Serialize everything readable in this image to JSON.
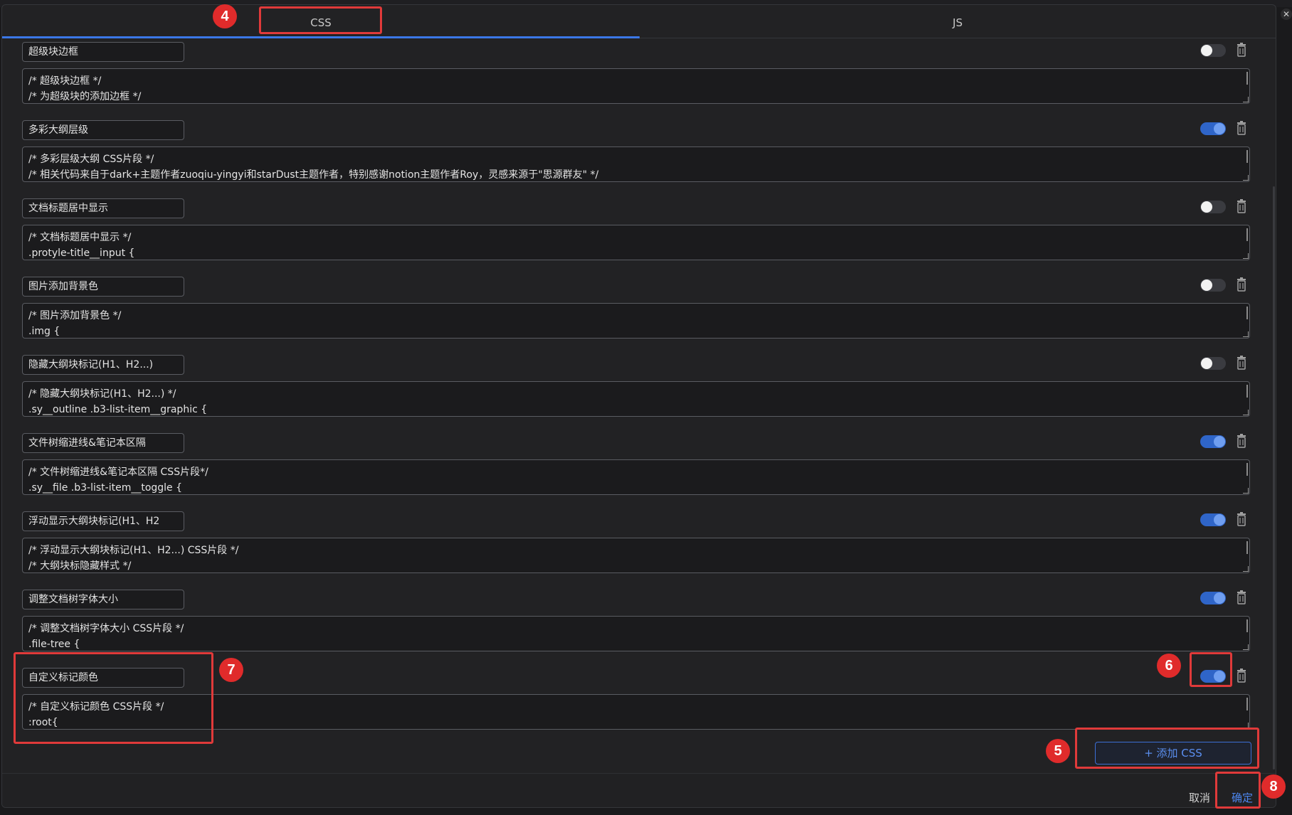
{
  "tabs": {
    "css_label": "CSS",
    "js_label": "JS"
  },
  "snippets": [
    {
      "name": "超级块边框",
      "enabled": false,
      "code": [
        "/* 超级块边框 */",
        "/* 为超级块的添加边框 */"
      ]
    },
    {
      "name": "多彩大纲层级",
      "enabled": true,
      "code": [
        "/* 多彩层级大纲 CSS片段 */",
        "/* 相关代码来自于dark+主题作者zuoqiu-yingyi和starDust主题作者，特别感谢notion主题作者Roy，灵感来源于\"思源群友\" */"
      ]
    },
    {
      "name": "文档标题居中显示",
      "enabled": false,
      "code": [
        "/* 文档标题居中显示 */",
        ".protyle-title__input {"
      ]
    },
    {
      "name": "图片添加背景色",
      "enabled": false,
      "code": [
        "/* 图片添加背景色 */",
        ".img {"
      ]
    },
    {
      "name": "隐藏大纲块标记(H1、H2...)",
      "enabled": false,
      "code": [
        "/* 隐藏大纲块标记(H1、H2...) */",
        ".sy__outline .b3-list-item__graphic {"
      ]
    },
    {
      "name": "文件树缩进线&笔记本区隔",
      "enabled": true,
      "code": [
        "/* 文件树缩进线&笔记本区隔 CSS片段*/",
        ".sy__file .b3-list-item__toggle {"
      ]
    },
    {
      "name": "浮动显示大纲块标记(H1、H2",
      "enabled": true,
      "code": [
        "/* 浮动显示大纲块标记(H1、H2...) CSS片段 */",
        "/* 大纲块标隐藏样式 */"
      ]
    },
    {
      "name": "调整文档树字体大小",
      "enabled": true,
      "code": [
        "/* 调整文档树字体大小 CSS片段 */",
        ".file-tree {"
      ]
    },
    {
      "name": "自定义标记颜色",
      "enabled": true,
      "code": [
        "/* 自定义标记颜色 CSS片段 */",
        ":root{"
      ]
    }
  ],
  "actions": {
    "add_css_label": "+ 添加 CSS",
    "cancel_label": "取消",
    "ok_label": "确定",
    "close_glyph": "✕"
  },
  "annotations": {
    "b4": "4",
    "b5": "5",
    "b6": "6",
    "b7": "7",
    "b8": "8"
  },
  "colors": {
    "accent": "#3b78e7",
    "annotation_red": "#e03a3a",
    "toggle_on": "#2f65c8",
    "background": "#222224"
  }
}
